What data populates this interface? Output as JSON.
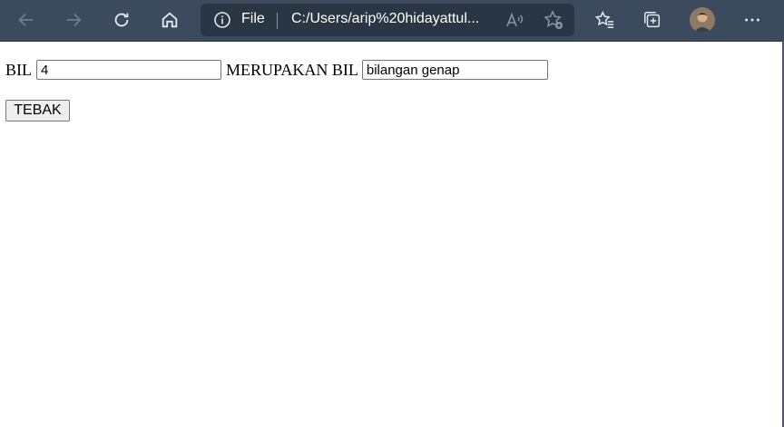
{
  "browser": {
    "address_scheme": "File",
    "address_url": "C:/Users/arip%20hidayattul..."
  },
  "form": {
    "label_bil": "BIL",
    "input_bil_value": "4",
    "label_merupakan": "MERUPAKAN BIL",
    "result_value": "bilangan genap",
    "button_label": "TEBAK"
  },
  "colors": {
    "toolbar_bg": "#3b4a5c",
    "address_bg": "#2b3644"
  }
}
